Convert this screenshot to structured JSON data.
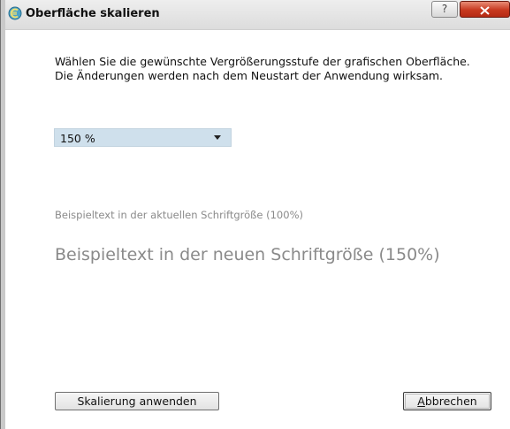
{
  "window": {
    "title": "Oberfläche skalieren",
    "help_label": "?",
    "close_label": "x"
  },
  "description": "Wählen Sie die gewünschte Vergrößerungsstufe der grafischen Oberfläche. Die Änderungen werden nach dem Neustart der Anwendung wirksam.",
  "scale_select": {
    "selected": "150 %"
  },
  "samples": {
    "current": "Beispieltext in der aktuellen Schriftgröße (100%)",
    "new": "Beispieltext in der neuen Schriftgröße (150%)"
  },
  "buttons": {
    "apply": "Skalierung anwenden",
    "cancel": "Abbrechen"
  },
  "colors": {
    "dropdown_bg": "#cfe0ec",
    "close_button": "#c7391f",
    "sample_text": "#8a8a8a"
  }
}
